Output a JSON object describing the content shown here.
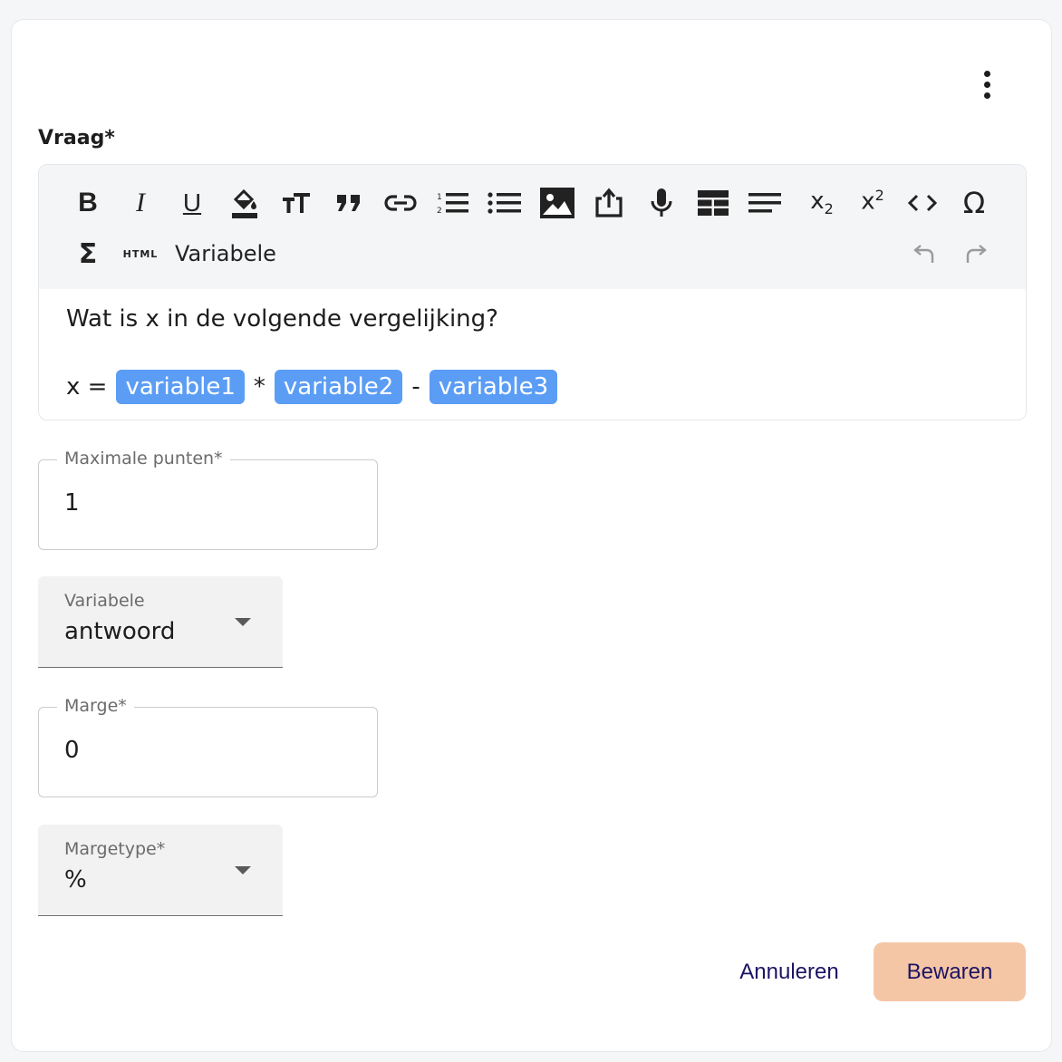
{
  "question": {
    "label": "Vraag*",
    "toolbar": {
      "items_row1": [
        {
          "name": "bold-icon",
          "glyph": "B"
        },
        {
          "name": "italic-icon",
          "glyph": "I"
        },
        {
          "name": "underline-icon",
          "glyph": "U"
        },
        {
          "name": "fill-color-icon"
        },
        {
          "name": "font-size-icon"
        },
        {
          "name": "blockquote-icon",
          "glyph": "99"
        },
        {
          "name": "link-icon"
        },
        {
          "name": "ordered-list-icon"
        },
        {
          "name": "bullet-list-icon"
        },
        {
          "name": "image-icon"
        },
        {
          "name": "upload-icon"
        },
        {
          "name": "microphone-icon"
        },
        {
          "name": "table-icon"
        },
        {
          "name": "align-icon"
        },
        {
          "name": "subscript-icon",
          "glyph": "x2"
        },
        {
          "name": "superscript-icon",
          "glyph": "x2"
        },
        {
          "name": "code-icon",
          "glyph": "<>"
        },
        {
          "name": "special-char-icon",
          "glyph": "Ω"
        }
      ],
      "sigma_glyph": "Σ",
      "html_label": "HTML",
      "variabele_label": "Variabele",
      "undo_icon": "undo-icon",
      "redo_icon": "redo-icon"
    },
    "content": {
      "line1": "Wat is x in de volgende vergelijking?",
      "prefix": "x =",
      "var1": "variable1",
      "op1": "*",
      "var2": "variable2",
      "op2": "-",
      "var3": "variable3"
    }
  },
  "max_points": {
    "label": "Maximale punten*",
    "value": "1"
  },
  "variable_select": {
    "label": "Variabele",
    "value": "antwoord"
  },
  "margin": {
    "label": "Marge*",
    "value": "0"
  },
  "margin_type": {
    "label": "Margetype*",
    "value": "%"
  },
  "actions": {
    "cancel": "Annuleren",
    "save": "Bewaren"
  },
  "colors": {
    "chip": "#5b9df5",
    "save_bg": "#f5c6a6",
    "action_text": "#1c1463",
    "toolbar_bg": "#f4f5f7"
  }
}
